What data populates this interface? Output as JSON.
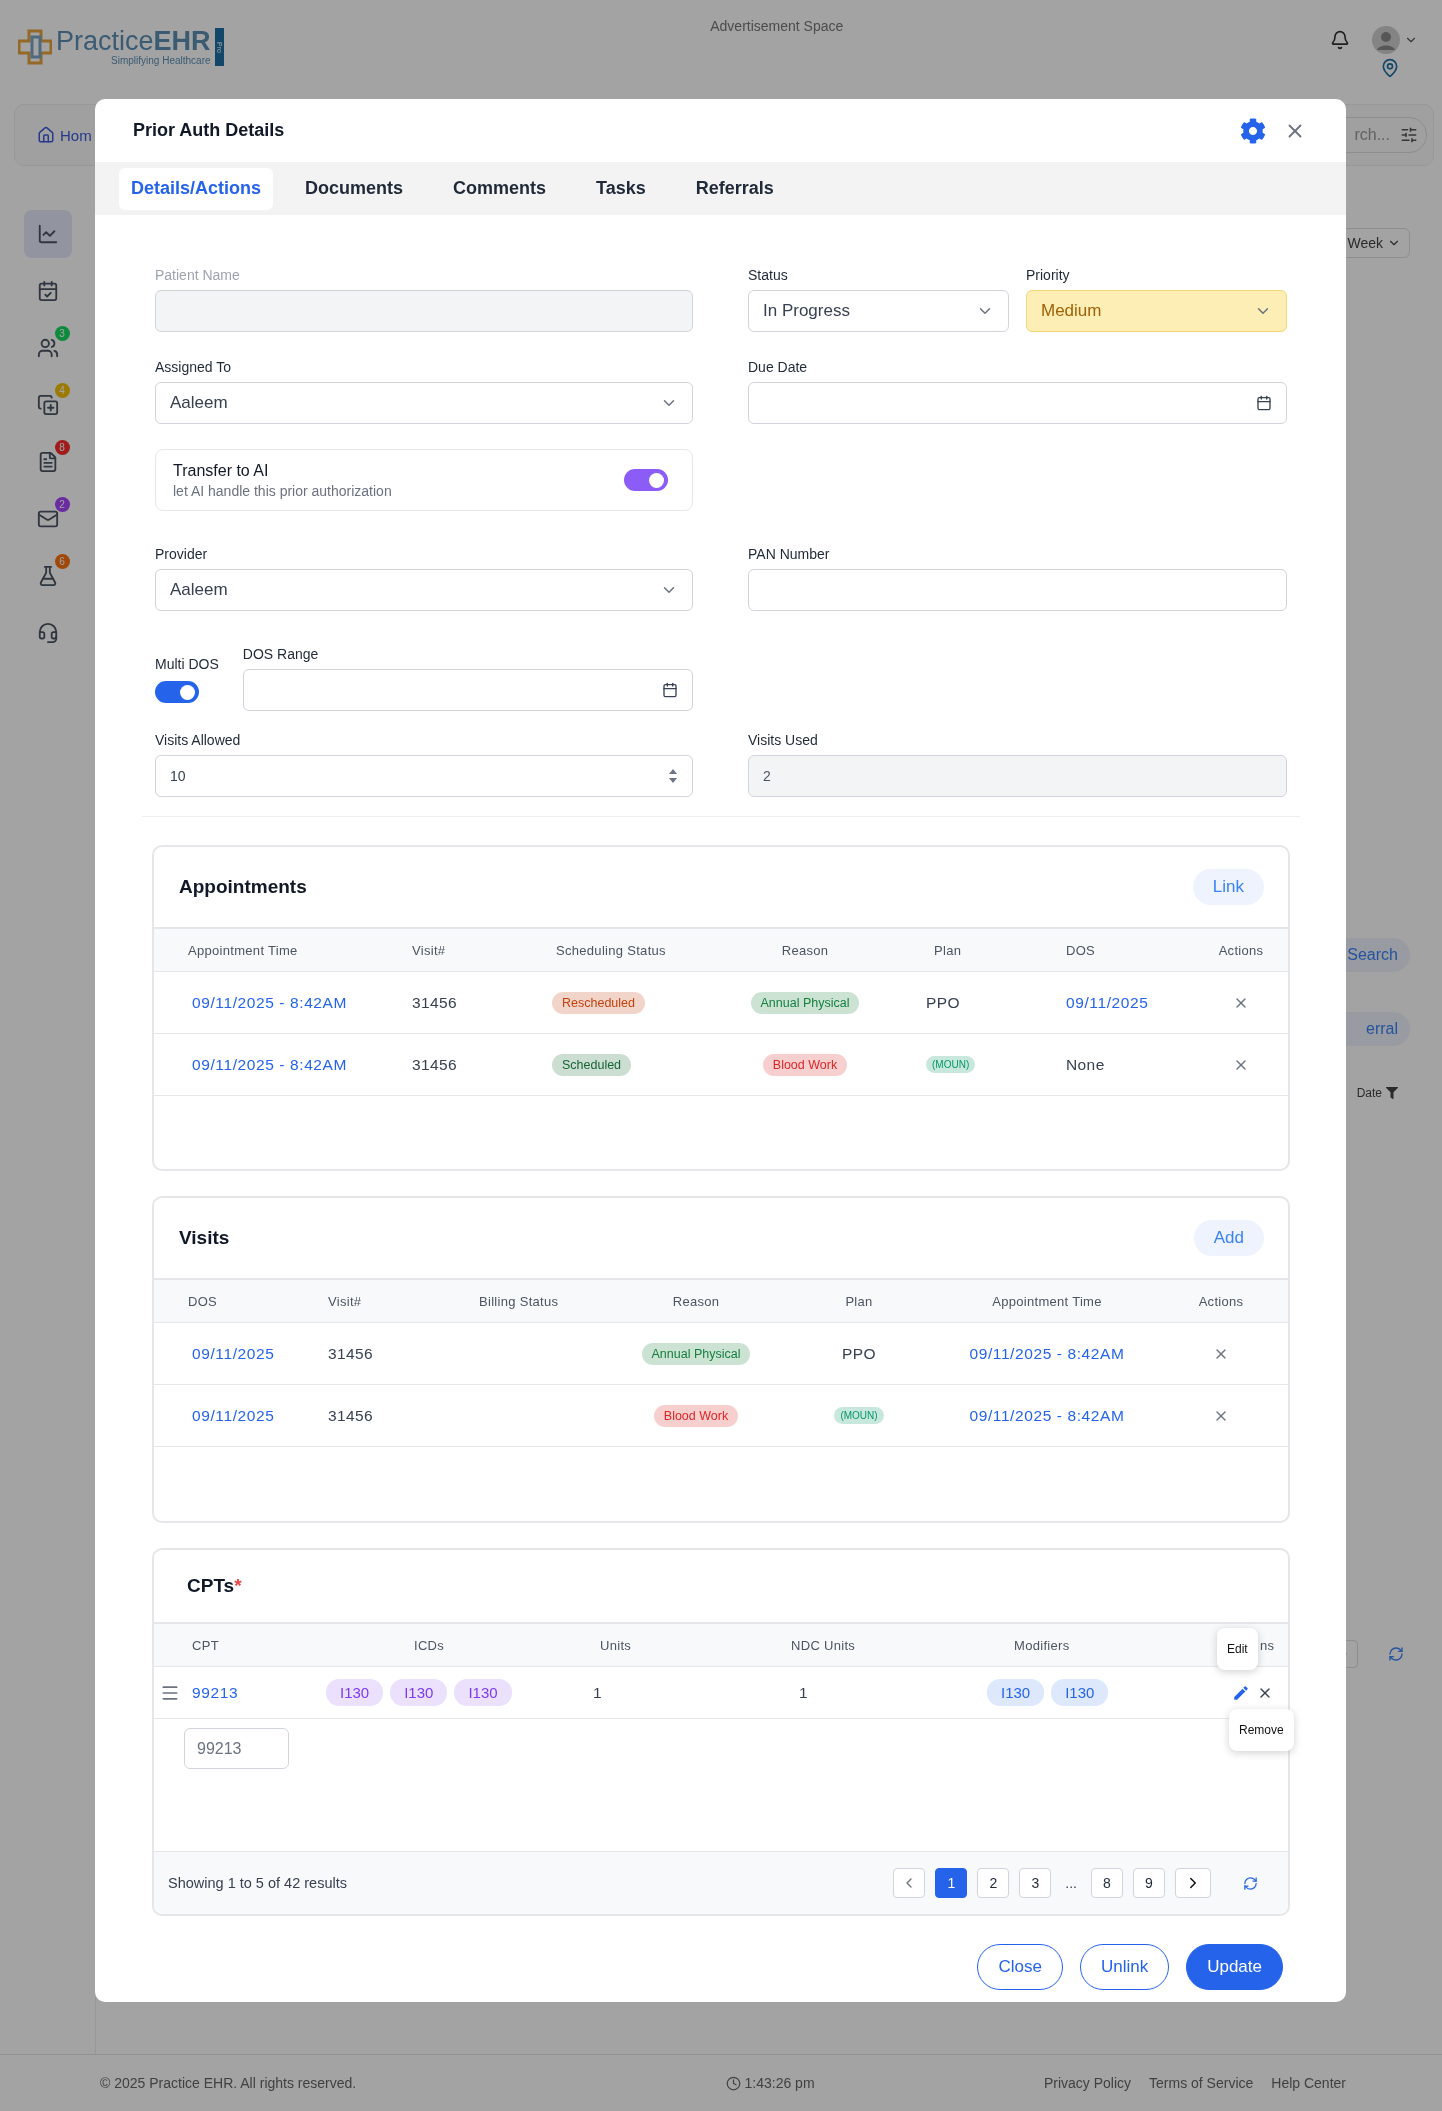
{
  "header": {
    "logo_text": "Practice**EHR**",
    "logo_tagline": "Simplifying Healthcare",
    "logo_badge": "Pro",
    "ad_text": "Advertisement Space"
  },
  "nav": {
    "home": "Hom",
    "search_text": "rch..."
  },
  "sidebar": {
    "items": [
      {
        "kind": "chart",
        "selected": true
      },
      {
        "kind": "calendar",
        "selected": false
      },
      {
        "kind": "users",
        "selected": false,
        "badge": "3",
        "color": "#0e8a3c"
      },
      {
        "kind": "add",
        "selected": false,
        "badge": "4",
        "color": "#9c7a04"
      },
      {
        "kind": "billing",
        "selected": false,
        "badge": "8",
        "color": "#a01c1c"
      },
      {
        "kind": "mail",
        "selected": false,
        "badge": "2",
        "color": "#6a2aa0"
      },
      {
        "kind": "lab",
        "selected": false,
        "badge": "6",
        "color": "#a0480a"
      },
      {
        "kind": "support",
        "selected": false
      }
    ]
  },
  "background_panel": {
    "range": "Week",
    "search_button": "Search",
    "referral_button": "erral",
    "date_column": "Date"
  },
  "footer": {
    "copyright": "© 2025 Practice EHR. All rights reserved.",
    "time": "1:43:26 pm",
    "links": [
      "Privacy Policy",
      "Terms of Service",
      "Help Center"
    ]
  },
  "modal": {
    "title": "Prior Auth Details",
    "tabs": [
      {
        "label": "Details/Actions",
        "selected": true
      },
      {
        "label": "Documents",
        "selected": false
      },
      {
        "label": "Comments",
        "selected": false
      },
      {
        "label": "Tasks",
        "selected": false
      },
      {
        "label": "Referrals",
        "selected": false
      }
    ],
    "form": {
      "patient_name": {
        "label": "Patient Name",
        "disabled": true
      },
      "status": {
        "label": "Status",
        "value": "In Progress"
      },
      "priority": {
        "label": "Priority",
        "value": "Medium"
      },
      "assigned_to": {
        "label": "Assigned To",
        "value": "Aaleem"
      },
      "due_date": {
        "label": "Due Date"
      },
      "transfer_to_ai": {
        "title": "Transfer to AI",
        "description": "let AI handle this prior authorization",
        "on": true
      },
      "provider": {
        "label": "Provider",
        "value": "Aaleem"
      },
      "pan_number": {
        "label": "PAN Number"
      },
      "multi_dos": {
        "label": "Multi DOS",
        "on": true
      },
      "dos_range": {
        "label": "DOS Range"
      },
      "visits_allowed": {
        "label": "Visits Allowed",
        "value": "10"
      },
      "visits_used": {
        "label": "Visits Used",
        "value": "2",
        "disabled": true
      }
    },
    "appointments": {
      "title": "Appointments",
      "action": "Link",
      "columns": [
        "Appointment Time",
        "Visit#",
        "Scheduling Status",
        "Reason",
        "Plan",
        "DOS",
        "Actions"
      ],
      "rows": [
        {
          "cells": [
            {
              "kind": "link",
              "text": "09/11/2025 - 8:42AM"
            },
            {
              "kind": "text",
              "text": "31456"
            },
            {
              "kind": "badge",
              "text": "Rescheduled",
              "color": "#c2410c"
            },
            {
              "kind": "badge",
              "text": "Annual Physical",
              "color": "#15803d"
            },
            {
              "kind": "text",
              "text": "PPO"
            },
            {
              "kind": "link",
              "text": "09/11/2025"
            }
          ]
        },
        {
          "cells": [
            {
              "kind": "link",
              "text": "09/11/2025 - 8:42AM"
            },
            {
              "kind": "text",
              "text": "31456"
            },
            {
              "kind": "badge",
              "text": "Scheduled",
              "color": "#166534"
            },
            {
              "kind": "badge",
              "text": "Blood Work",
              "color": "#dc2626"
            },
            {
              "kind": "tag",
              "text": "(MOUN)",
              "color": "#059669"
            },
            {
              "kind": "text",
              "text": "None"
            }
          ]
        }
      ]
    },
    "visits": {
      "title": "Visits",
      "action": "Add",
      "columns": [
        "DOS",
        "Visit#",
        "Billing Status",
        "Reason",
        "Plan",
        "Appointment Time",
        "Actions"
      ],
      "rows": [
        {
          "cells": [
            {
              "kind": "link",
              "text": "09/11/2025"
            },
            {
              "kind": "text",
              "text": "31456"
            },
            null,
            {
              "kind": "badge",
              "text": "Annual Physical",
              "color": "#15803d"
            },
            {
              "kind": "text",
              "text": "PPO"
            },
            {
              "kind": "link",
              "text": "09/11/2025 - 8:42AM"
            }
          ]
        },
        {
          "cells": [
            {
              "kind": "link",
              "text": "09/11/2025"
            },
            {
              "kind": "text",
              "text": "31456"
            },
            null,
            {
              "kind": "badge",
              "text": "Blood Work",
              "color": "#dc2626"
            },
            {
              "kind": "tag",
              "text": "(MOUN)",
              "color": "#059669"
            },
            {
              "kind": "link",
              "text": "09/11/2025 - 8:42AM"
            }
          ]
        }
      ]
    },
    "cpts": {
      "title": "CPTs",
      "required_mark": "*",
      "columns": [
        "CPT",
        "ICDs",
        "Units",
        "NDC Units",
        "Modifiers",
        "ns"
      ],
      "rows": [
        {
          "cpt": "99213",
          "icds": [
            "I130",
            "I130",
            "I130"
          ],
          "units": "1",
          "ndc_units": "1",
          "modifiers": [
            "I130",
            "I130"
          ]
        }
      ],
      "cpt_input": {
        "placeholder": "99213"
      },
      "tooltips": {
        "edit": "Edit",
        "remove": "Remove"
      },
      "summary": "Showing 1 to 5 of 42 results",
      "pagination": {
        "pages": [
          {
            "kind": "page",
            "label": "1",
            "selected": true
          },
          {
            "kind": "page",
            "label": "2",
            "selected": false
          },
          {
            "kind": "page",
            "label": "3",
            "selected": false
          },
          {
            "kind": "ellipsis",
            "label": "...",
            "selected": false
          },
          {
            "kind": "page",
            "label": "8",
            "selected": false
          },
          {
            "kind": "page",
            "label": "9",
            "selected": false
          }
        ]
      }
    },
    "buttons": [
      {
        "label": "Close",
        "kind": "outline"
      },
      {
        "label": "Unlink",
        "kind": "outline"
      },
      {
        "label": "Update",
        "kind": "primary"
      }
    ]
  }
}
